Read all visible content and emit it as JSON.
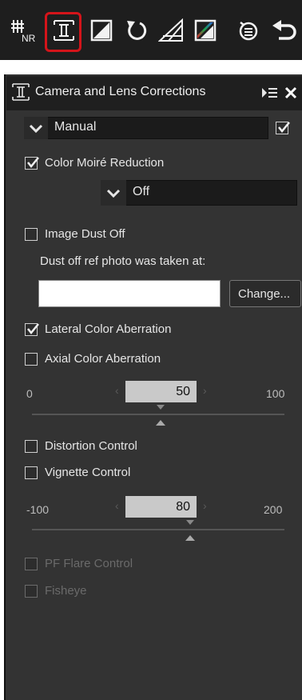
{
  "toolbar": {
    "tools": [
      {
        "name": "noise-reduction-icon",
        "text": "NR"
      },
      {
        "name": "camera-lens-corrections-icon",
        "selected": true
      },
      {
        "name": "exposure-compensation-icon"
      },
      {
        "name": "rotate-icon"
      },
      {
        "name": "perspective-icon"
      },
      {
        "name": "color-balance-icon"
      },
      {
        "name": "adjustment-history-icon"
      },
      {
        "name": "undo-icon"
      }
    ]
  },
  "panel": {
    "title": "Camera and Lens Corrections",
    "menu_icon": "panel-menu-icon",
    "close_icon": "close-icon",
    "preset": {
      "value": "Manual",
      "checked": true
    },
    "color_moire": {
      "label": "Color Moiré Reduction",
      "checked": true,
      "value": "Off"
    },
    "dust": {
      "label": "Image Dust Off",
      "checked": false,
      "note": "Dust off ref photo was taken at:",
      "field_value": "",
      "button": "Change..."
    },
    "lateral": {
      "label": "Lateral Color Aberration",
      "checked": true
    },
    "axial": {
      "label": "Axial Color Aberration",
      "checked": false,
      "min": "0",
      "value": "50",
      "max": "100"
    },
    "distortion": {
      "label": "Distortion Control",
      "checked": false
    },
    "vignette": {
      "label": "Vignette Control",
      "checked": false,
      "min": "-100",
      "value": "80",
      "max": "200"
    },
    "pf_flare": {
      "label": "PF Flare Control",
      "checked": false,
      "enabled": false
    },
    "fisheye": {
      "label": "Fisheye",
      "checked": false,
      "enabled": false
    }
  },
  "colors": {
    "accent": "#d4141a",
    "panel": "#333333",
    "toolbar": "#1e1e1e"
  }
}
